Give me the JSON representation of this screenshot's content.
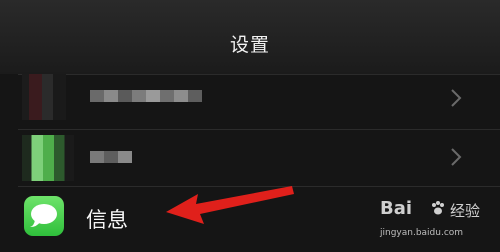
{
  "header": {
    "title": "设置"
  },
  "rows": [
    {
      "label": "信息",
      "icon": "messages-icon",
      "accent": "#34c759"
    }
  ],
  "watermark": {
    "brand": "Bai",
    "text": "经验",
    "url": "jingyan.baidu.com"
  },
  "colors": {
    "background": "#151515",
    "header": "#222222",
    "arrow": "#e0201b"
  }
}
